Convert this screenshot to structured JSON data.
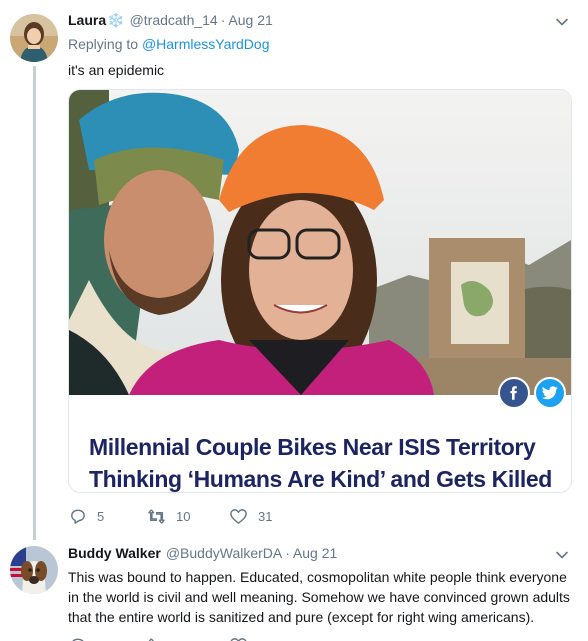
{
  "colors": {
    "link_blue": "#1b95e0",
    "secondary_text": "#657786",
    "card_title": "#1d2462",
    "facebook": "#36558f",
    "twitter": "#1da1f2"
  },
  "tweets": [
    {
      "author_name": "Laura",
      "author_badge": "❄️",
      "handle": "@tradcath_14",
      "separator": "·",
      "date": "Aug 21",
      "replying_prefix": "Replying to ",
      "replying_handle": "@HarmlessYardDog",
      "text": "it's an epidemic",
      "card": {
        "title_line_1": "Millennial Couple Bikes Near ISIS Territory",
        "title_line_2": "Thinking ‘Humans Are Kind’ and Gets Killed",
        "share_icons": [
          "facebook-icon",
          "twitter-icon"
        ]
      },
      "actions": {
        "replies": "5",
        "retweets": "10",
        "likes": "31"
      }
    },
    {
      "author_name": "Buddy Walker",
      "handle": "@BuddyWalkerDA",
      "separator": "·",
      "date": "Aug 21",
      "text": "This was bound to happen. Educated, cosmopolitan white people think everyone in the world is civil and well meaning. Somehow we have convinced grown adults that the entire world is sanitized and pure (except for right wing americans)."
    }
  ]
}
